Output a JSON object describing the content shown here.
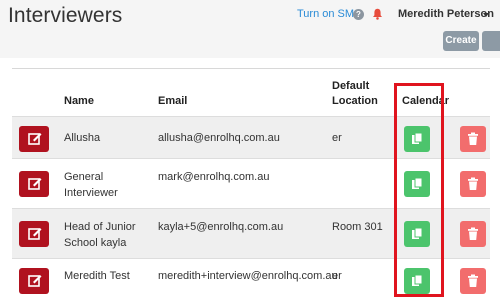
{
  "header": {
    "title": "Interviewers",
    "sms_link": "Turn on SMS",
    "user_name": "Meredith Peterson",
    "create_label": "Create"
  },
  "table": {
    "columns": {
      "name": "Name",
      "email": "Email",
      "default_location": "Default\nLocation",
      "calendar": "Calendar"
    },
    "rows": [
      {
        "name": "Allusha",
        "email": "allusha@enrolhq.com.au",
        "location": "er"
      },
      {
        "name": "General\nInterviewer",
        "email": "mark@enrolhq.com.au",
        "location": ""
      },
      {
        "name": "Head of Junior\nSchool kayla",
        "email": "kayla+5@enrolhq.com.au",
        "location": "Room 301"
      },
      {
        "name": "Meredith Test",
        "email": "meredith+interview@enrolhq.com.au",
        "location": "er"
      }
    ]
  },
  "colors": {
    "edit": "#b0121f",
    "calendar": "#4cc46c",
    "delete": "#f26d6d",
    "highlight": "#e0141e",
    "link": "#2a8bd6"
  },
  "icons": {
    "edit": "pencil-square-icon",
    "calendar": "copy-icon",
    "delete": "trash-icon",
    "help": "question-circle-icon",
    "notifications": "bell-icon"
  }
}
